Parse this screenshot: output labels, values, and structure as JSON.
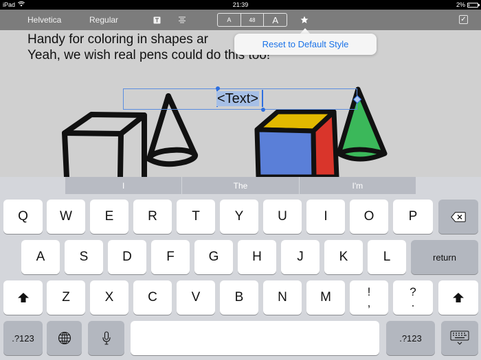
{
  "status_bar": {
    "device": "iPad",
    "time": "21:39",
    "battery": "2%",
    "battery_level": 0.02
  },
  "toolbar": {
    "font_name": "Helvetica",
    "font_style": "Regular",
    "text_icon": "text-format-icon",
    "align_icon": "align-center-icon",
    "size_decrease": "A",
    "font_size": "48",
    "size_increase": "A",
    "favorite_icon": "star-icon",
    "done_icon": "checkbox-icon"
  },
  "popover": {
    "reset_label": "Reset to Default Style"
  },
  "canvas": {
    "line1": "Handy for coloring in shapes ar",
    "line2": "Yeah, we wish real pens could do this too!",
    "text_box": "<Text>"
  },
  "colors": {
    "cube_top": "#e2b900",
    "cube_left": "#5a7fd8",
    "cube_right": "#d9352b",
    "cone": "#3bb85a",
    "selection": "#2d6fe0"
  },
  "keyboard": {
    "predictions": [
      "I",
      "The",
      "I'm"
    ],
    "row1": [
      "Q",
      "W",
      "E",
      "R",
      "T",
      "Y",
      "U",
      "I",
      "O",
      "P"
    ],
    "row2": [
      "A",
      "S",
      "D",
      "F",
      "G",
      "H",
      "J",
      "K",
      "L"
    ],
    "row3": [
      "Z",
      "X",
      "C",
      "V",
      "B",
      "N",
      "M"
    ],
    "punct1_top": "!",
    "punct1_bottom": ",",
    "punct2_top": "?",
    "punct2_bottom": ".",
    "return_label": "return",
    "numbers_label": ".?123",
    "numbers_label_right": ".?123",
    "backspace_icon": "backspace-icon",
    "shift_icon": "shift-icon",
    "globe_icon": "globe-icon",
    "mic_icon": "microphone-icon",
    "hide_icon": "keyboard-hide-icon"
  }
}
